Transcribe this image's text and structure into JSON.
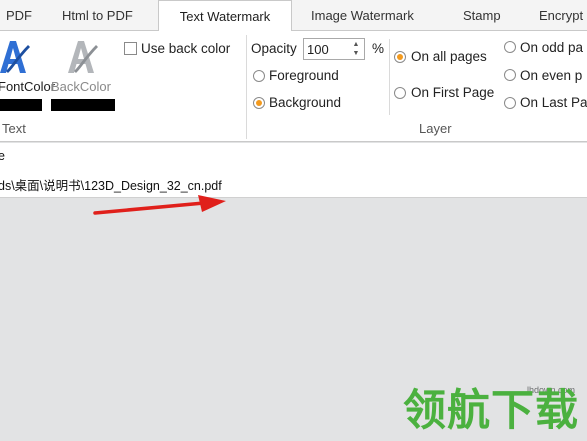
{
  "tabs": [
    {
      "label": "PDF",
      "active": false
    },
    {
      "label": "Html to PDF",
      "active": false
    },
    {
      "label": "Text Watermark",
      "active": true
    },
    {
      "label": "Image Watermark",
      "active": false
    },
    {
      "label": "Stamp",
      "active": false
    },
    {
      "label": "Encrypt",
      "active": false
    }
  ],
  "text_group": {
    "label": "Text",
    "font_color_label": "FontColor",
    "font_color_value": "#000000",
    "back_color_label": "BackColor",
    "back_color_value": "#000000",
    "use_back_color_label": "Use back color",
    "use_back_color_checked": false
  },
  "layer_group": {
    "label": "Layer",
    "opacity_label": "Opacity",
    "opacity_value": "100",
    "opacity_unit": "%",
    "foreground_label": "Foreground",
    "background_label": "Background",
    "layer_selected": "Background",
    "on_all_pages_label": "On all pages",
    "on_first_page_label": "On First Page",
    "pages_selected": "On all pages",
    "on_odd_pages_label": "On odd pa",
    "on_even_pages_label": "On even p",
    "on_last_page_label": "On Last Pa"
  },
  "file": {
    "header": "e",
    "path": "ds\\桌面\\说明书\\123D_Design_32_cn.pdf"
  },
  "watermark": {
    "domain": "lhdown.com",
    "text": "领航下载"
  },
  "colors": {
    "accent_orange": "#f39a1e",
    "arrow_red": "#e0201b",
    "watermark_green": "#4bb13f",
    "icon_blue": "#2f6fd4"
  }
}
